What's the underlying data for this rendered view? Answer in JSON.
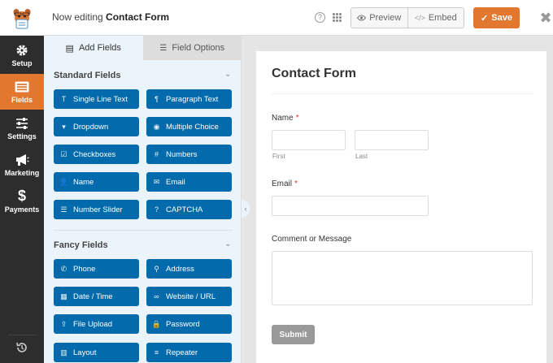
{
  "header": {
    "editing_prefix": "Now editing",
    "form_name": "Contact Form",
    "preview_label": "Preview",
    "embed_label": "Embed",
    "save_label": "Save",
    "help_glyph": "?",
    "close_glyph": "✖"
  },
  "nav": {
    "items": [
      {
        "label": "Setup",
        "icon": "gear-icon"
      },
      {
        "label": "Fields",
        "icon": "fields-list-icon",
        "active": true
      },
      {
        "label": "Settings",
        "icon": "sliders-icon"
      },
      {
        "label": "Marketing",
        "icon": "megaphone-icon"
      },
      {
        "label": "Payments",
        "icon": "dollar-icon"
      }
    ],
    "revisions_icon": "history-icon"
  },
  "panel": {
    "tabs": {
      "add_fields": "Add Fields",
      "field_options": "Field Options"
    },
    "standard_title": "Standard Fields",
    "standard_fields": [
      {
        "label": "Single Line Text",
        "icon": "T"
      },
      {
        "label": "Paragraph Text",
        "icon": "¶"
      },
      {
        "label": "Dropdown",
        "icon": "▾"
      },
      {
        "label": "Multiple Choice",
        "icon": "◉"
      },
      {
        "label": "Checkboxes",
        "icon": "☑"
      },
      {
        "label": "Numbers",
        "icon": "#"
      },
      {
        "label": "Name",
        "icon": "👤"
      },
      {
        "label": "Email",
        "icon": "✉"
      },
      {
        "label": "Number Slider",
        "icon": "☰"
      },
      {
        "label": "CAPTCHA",
        "icon": "?"
      }
    ],
    "fancy_title": "Fancy Fields",
    "fancy_fields": [
      {
        "label": "Phone",
        "icon": "✆"
      },
      {
        "label": "Address",
        "icon": "⚲"
      },
      {
        "label": "Date / Time",
        "icon": "▦"
      },
      {
        "label": "Website / URL",
        "icon": "∞"
      },
      {
        "label": "File Upload",
        "icon": "⇪"
      },
      {
        "label": "Password",
        "icon": "🔒"
      },
      {
        "label": "Layout",
        "icon": "▥"
      },
      {
        "label": "Repeater",
        "icon": "≡"
      }
    ]
  },
  "form": {
    "title": "Contact Form",
    "name_label": "Name",
    "required_mark": "*",
    "first_sublabel": "First",
    "last_sublabel": "Last",
    "email_label": "Email",
    "comment_label": "Comment or Message",
    "submit_label": "Submit"
  },
  "colors": {
    "accent_orange": "#e27730",
    "field_button_blue": "#036aab",
    "nav_dark": "#2d2d2d"
  }
}
